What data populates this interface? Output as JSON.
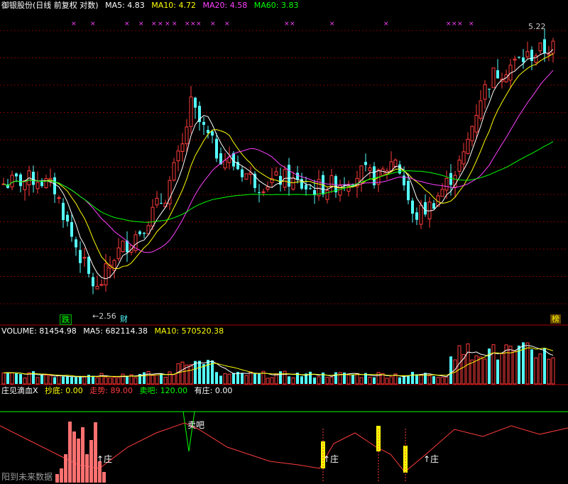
{
  "colors": {
    "up": "#ff3c3c",
    "down": "#54ffff",
    "ma5": "#ffffff",
    "ma10": "#ffff00",
    "ma20": "#ff40ff",
    "ma60": "#00ff00",
    "grid": "#7a0000"
  },
  "main": {
    "title": "御银股份(日线 前复权 对数)",
    "ma5": "MA5: 4.83",
    "ma10": "MA10: 4.72",
    "ma20": "MA20: 4.58",
    "ma60": "MA60: 3.83",
    "high_label": "5.22",
    "low_label": "←2.56",
    "badge_die": "跌",
    "badge_cai": "财",
    "badge_bang": "榜"
  },
  "volume": {
    "volume": "VOLUME: 81454.98",
    "ma5": "MA5: 682114.38",
    "ma10": "MA10: 570520.38"
  },
  "indicator": {
    "title": "庄见滴血X",
    "chaodi": "抄底: 0.00",
    "zoushi": "走势: 89.00",
    "maiba": "卖吧: 120.00",
    "youzhuang": "有庄: 0.00",
    "sell_label": "卖吧",
    "zhuang_label": "↑庄",
    "watermark": "阳到未来数据"
  },
  "chart_data": {
    "type": "candlestick",
    "price_range": [
      2.56,
      5.22
    ],
    "high": 5.22,
    "low": 2.56,
    "last_close_ma5": 4.83,
    "ma_last": {
      "MA5": 4.83,
      "MA10": 4.72,
      "MA20": 4.58,
      "MA60": 3.83
    },
    "volume_last": 81454.98,
    "volume_ma_last": {
      "MA5": 682114.38,
      "MA10": 570520.38
    },
    "indicator_last": {
      "抄底": 0.0,
      "走势": 89.0,
      "卖吧": 120.0,
      "有庄": 0.0
    }
  }
}
